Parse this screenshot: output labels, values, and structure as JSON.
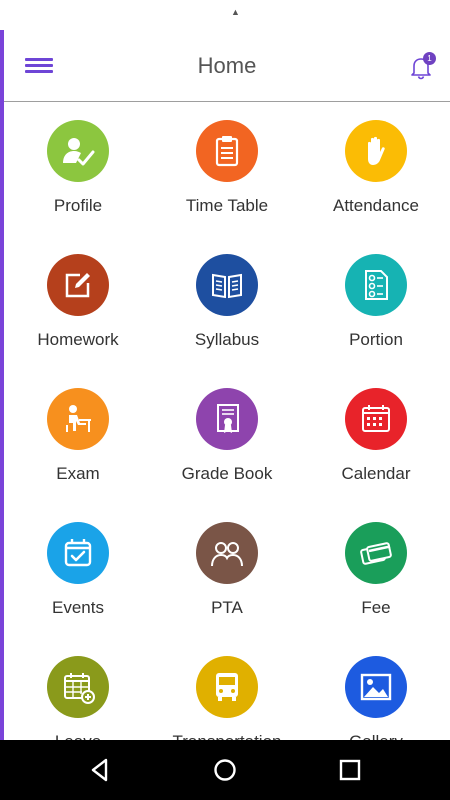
{
  "status": {
    "indicator": "▲"
  },
  "header": {
    "title": "Home",
    "notification_count": "1"
  },
  "tiles": [
    {
      "label": "Profile",
      "color": "#8cc63f",
      "icon": "profile-icon"
    },
    {
      "label": "Time Table",
      "color": "#f26522",
      "icon": "clipboard-icon"
    },
    {
      "label": "Attendance",
      "color": "#fbbc05",
      "icon": "hand-icon"
    },
    {
      "label": "Homework",
      "color": "#b5401c",
      "icon": "edit-icon"
    },
    {
      "label": "Syllabus",
      "color": "#1e4fa0",
      "icon": "book-icon"
    },
    {
      "label": "Portion",
      "color": "#16b3b3",
      "icon": "document-icon"
    },
    {
      "label": "Exam",
      "color": "#f7901e",
      "icon": "student-desk-icon"
    },
    {
      "label": "Grade Book",
      "color": "#8e44ad",
      "icon": "certificate-icon"
    },
    {
      "label": "Calendar",
      "color": "#e8232a",
      "icon": "calendar-icon"
    },
    {
      "label": "Events",
      "color": "#1aa3e8",
      "icon": "event-check-icon"
    },
    {
      "label": "PTA",
      "color": "#7a5547",
      "icon": "people-icon"
    },
    {
      "label": "Fee",
      "color": "#1a9e5a",
      "icon": "cards-icon"
    },
    {
      "label": "Leave",
      "color": "#8a9a1b",
      "icon": "calendar-add-icon"
    },
    {
      "label": "Transportation",
      "color": "#e0b000",
      "icon": "bus-icon"
    },
    {
      "label": "Gallery",
      "color": "#1d5be0",
      "icon": "image-icon"
    }
  ],
  "nav": {
    "back": "back",
    "home": "home",
    "recents": "recents"
  }
}
